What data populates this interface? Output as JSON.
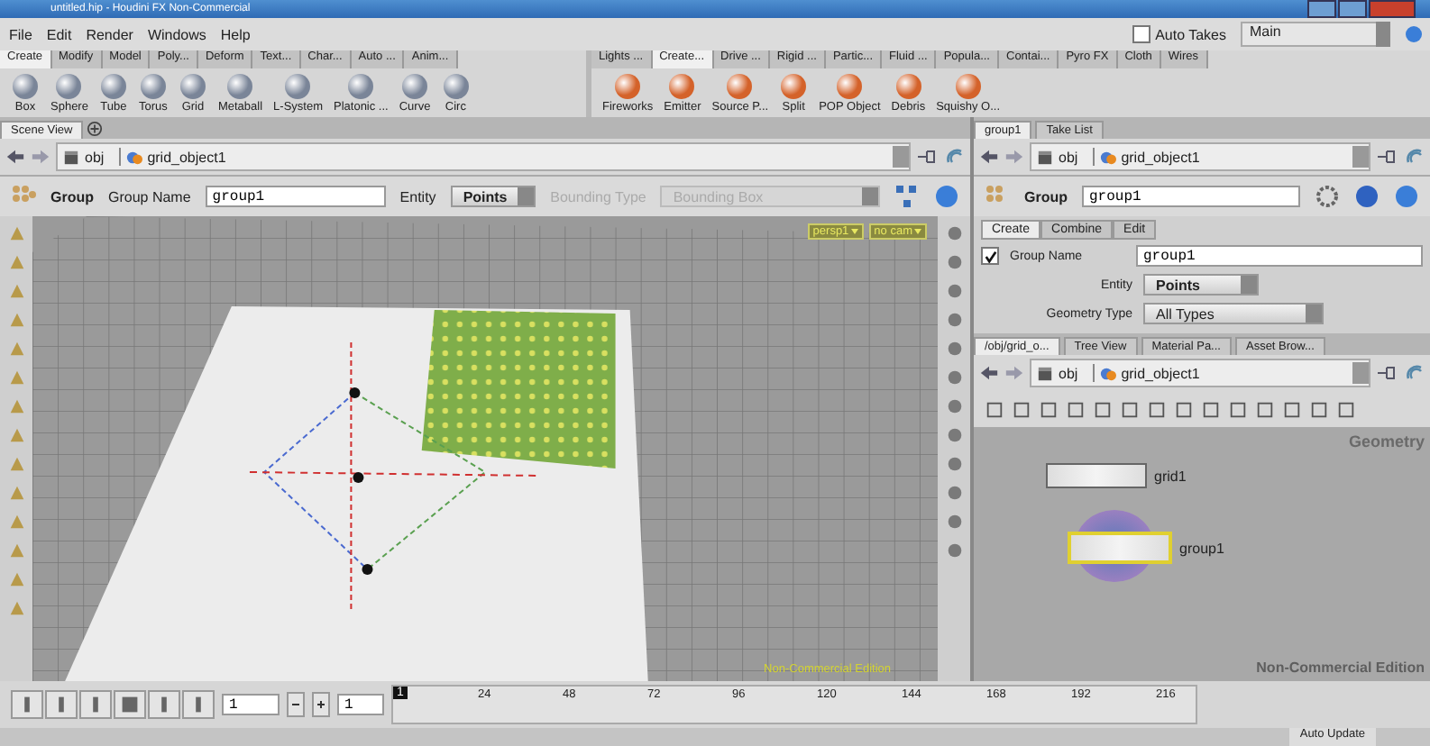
{
  "window": {
    "title": "untitled.hip - Houdini FX Non-Commercial"
  },
  "menu": [
    "File",
    "Edit",
    "Render",
    "Windows",
    "Help"
  ],
  "auto_takes": {
    "label": "Auto Takes",
    "checked": false
  },
  "take": {
    "value": "Main"
  },
  "shelf_left": {
    "tabs": [
      {
        "label": "Create",
        "selected": true
      },
      {
        "label": "Modify",
        "selected": false
      },
      {
        "label": "Model",
        "selected": false
      },
      {
        "label": "Poly...",
        "selected": false
      },
      {
        "label": "Deform",
        "selected": false
      },
      {
        "label": "Text...",
        "selected": false
      },
      {
        "label": "Char...",
        "selected": false
      },
      {
        "label": "Auto ...",
        "selected": false
      },
      {
        "label": "Anim...",
        "selected": false
      }
    ],
    "tools": [
      "Box",
      "Sphere",
      "Tube",
      "Torus",
      "Grid",
      "Metaball",
      "L-System",
      "Platonic ...",
      "Curve",
      "Circ"
    ]
  },
  "shelf_right": {
    "tabs": [
      {
        "label": "Lights ...",
        "selected": false
      },
      {
        "label": "Create...",
        "selected": true
      },
      {
        "label": "Drive ...",
        "selected": false
      },
      {
        "label": "Rigid ...",
        "selected": false
      },
      {
        "label": "Partic...",
        "selected": false
      },
      {
        "label": "Fluid ...",
        "selected": false
      },
      {
        "label": "Popula...",
        "selected": false
      },
      {
        "label": "Contai...",
        "selected": false
      },
      {
        "label": "Pyro FX",
        "selected": false
      },
      {
        "label": "Cloth",
        "selected": false
      },
      {
        "label": "Wires",
        "selected": false
      }
    ],
    "tools": [
      "Fireworks",
      "Emitter",
      "Source P...",
      "Split",
      "POP Object",
      "Debris",
      "Squishy O..."
    ]
  },
  "scene_view": {
    "tab": "Scene View",
    "path": {
      "root": "obj",
      "node": "grid_object1"
    },
    "toolbar": {
      "tool": "Group",
      "name_label": "Group Name",
      "name_value": "group1",
      "entity_label": "Entity",
      "entity_value": "Points",
      "bounding_label": "Bounding Type",
      "bounding_value": "Bounding Box",
      "bounding_disabled": true
    },
    "camera": "persp1",
    "cam_menu": "no cam",
    "edition": "Non-Commercial Edition"
  },
  "parameters": {
    "tabs": [
      {
        "label": "group1",
        "selected": true
      },
      {
        "label": "Take List",
        "selected": false
      }
    ],
    "path": {
      "root": "obj",
      "node": "grid_object1"
    },
    "node_type": "Group",
    "node_name": "group1",
    "param_tabs": [
      {
        "label": "Create",
        "selected": true
      },
      {
        "label": "Combine",
        "selected": false
      },
      {
        "label": "Edit",
        "selected": false
      }
    ],
    "group_name": {
      "label": "Group Name",
      "checked": true,
      "value": "group1"
    },
    "entity": {
      "label": "Entity",
      "value": "Points"
    },
    "geometry_type": {
      "label": "Geometry Type",
      "value": "All Types"
    }
  },
  "network": {
    "tabs": [
      {
        "label": "/obj/grid_o...",
        "selected": true
      },
      {
        "label": "Tree View",
        "selected": false
      },
      {
        "label": "Material Pa...",
        "selected": false
      },
      {
        "label": "Asset Brow...",
        "selected": false
      }
    ],
    "path": {
      "root": "obj",
      "node": "grid_object1"
    },
    "context": "Geometry",
    "edition": "Non-Commercial Edition",
    "nodes": [
      {
        "name": "grid1",
        "selected": false
      },
      {
        "name": "group1",
        "selected": true
      }
    ]
  },
  "timeline": {
    "frame": "1",
    "start": "1",
    "current": "1",
    "ticks": [
      "24",
      "48",
      "72",
      "96",
      "120",
      "144",
      "168",
      "192",
      "216"
    ]
  },
  "status": {
    "auto_update": "Auto Update"
  }
}
